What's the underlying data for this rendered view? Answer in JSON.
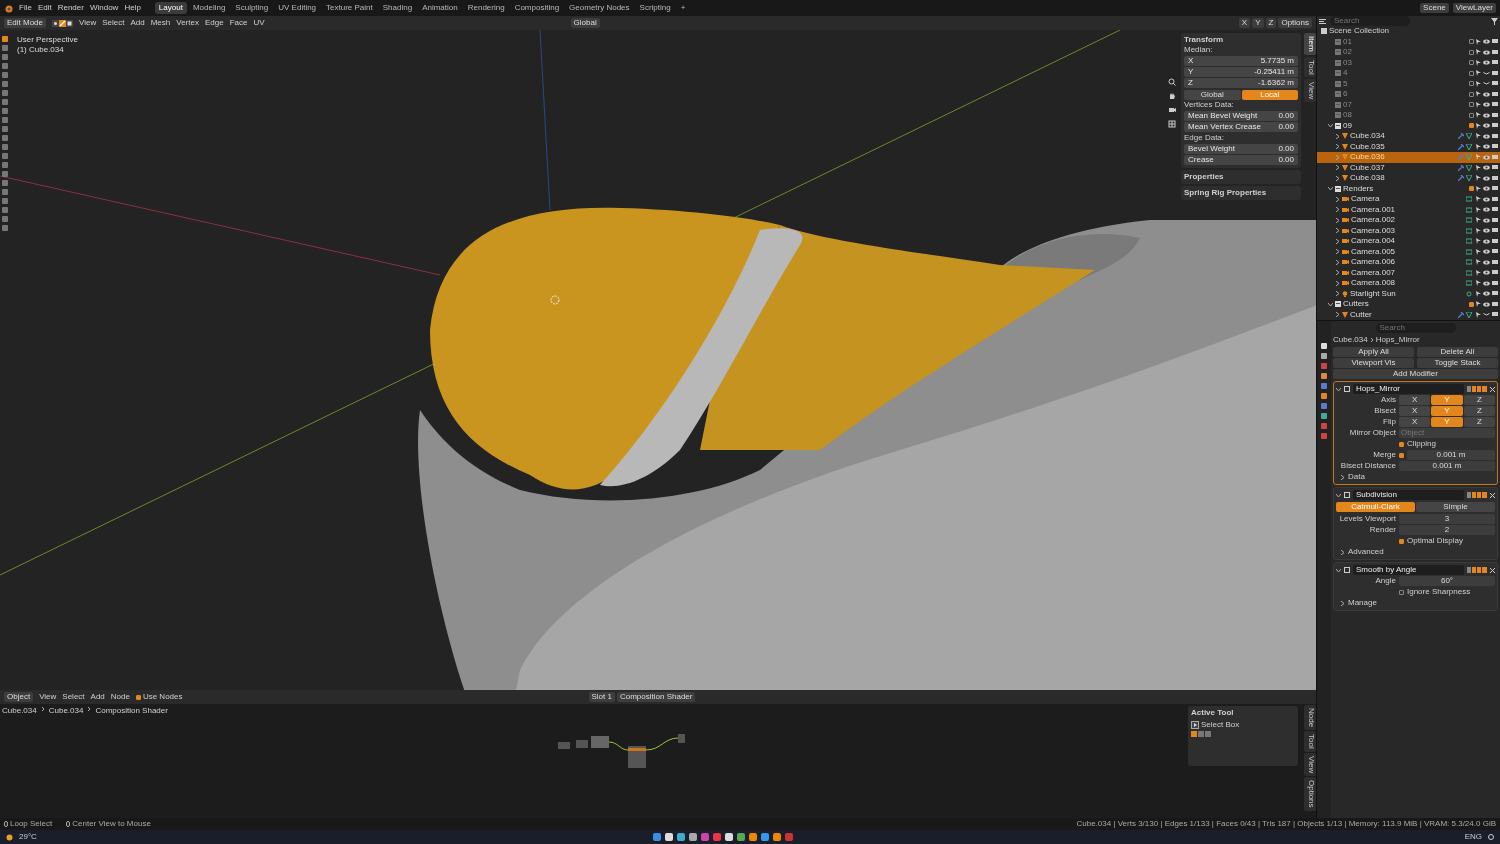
{
  "top_bar": {
    "menus": [
      "File",
      "Edit",
      "Render",
      "Window",
      "Help"
    ],
    "workspaces": [
      {
        "label": "Layout",
        "selected": true
      },
      {
        "label": "Modeling",
        "selected": false
      },
      {
        "label": "Sculpting",
        "selected": false
      },
      {
        "label": "UV Editing",
        "selected": false
      },
      {
        "label": "Texture Paint",
        "selected": false
      },
      {
        "label": "Shading",
        "selected": false
      },
      {
        "label": "Animation",
        "selected": false
      },
      {
        "label": "Rendering",
        "selected": false
      },
      {
        "label": "Compositing",
        "selected": false
      },
      {
        "label": "Geometry Nodes",
        "selected": false
      },
      {
        "label": "Scripting",
        "selected": false
      }
    ],
    "add_tab": "+",
    "scene": "Scene",
    "view_layer": "ViewLayer"
  },
  "viewport_header": {
    "mode": "Edit Mode",
    "select_modes": [
      {
        "kind": "vertex",
        "selected": false
      },
      {
        "kind": "edge",
        "selected": true
      },
      {
        "kind": "face",
        "selected": false
      }
    ],
    "menus": [
      "View",
      "Select",
      "Add",
      "Mesh",
      "Vertex",
      "Edge",
      "Face",
      "UV"
    ],
    "orientation": "Global",
    "axes": [
      "X",
      "Y",
      "Z"
    ],
    "options": "Options"
  },
  "viewport": {
    "perspective": "User Perspective",
    "object": "(1) Cube.034"
  },
  "n_panel": {
    "title": "Transform",
    "median_label": "Median:",
    "median": [
      {
        "label": "X",
        "value": "5.7735 m"
      },
      {
        "label": "Y",
        "value": "-0.25411 m"
      },
      {
        "label": "Z",
        "value": "-1.6362 m"
      }
    ],
    "space": [
      {
        "label": "Global",
        "selected": false
      },
      {
        "label": "Local",
        "selected": true
      }
    ],
    "vertices_label": "Vertices Data:",
    "vertices": [
      {
        "label": "Mean Bevel Weight",
        "value": "0.00"
      },
      {
        "label": "Mean Vertex Crease",
        "value": "0.00"
      }
    ],
    "edges_label": "Edge Data:",
    "edges": [
      {
        "label": "Bevel Weight",
        "value": "0.00"
      },
      {
        "label": "Crease",
        "value": "0.00"
      }
    ],
    "collapsed_panels": [
      "Properties",
      "Spring Rig Properties"
    ],
    "tabs": [
      {
        "label": "Item",
        "selected": true
      },
      {
        "label": "Tool",
        "selected": false
      },
      {
        "label": "View",
        "selected": false
      }
    ]
  },
  "outliner": {
    "search_placeholder": "Search",
    "root": "Scene Collection",
    "items": [
      {
        "label": "01",
        "kind": "collection",
        "checked": false,
        "visible": true
      },
      {
        "label": "02",
        "kind": "collection",
        "checked": false,
        "visible": true
      },
      {
        "label": "03",
        "kind": "collection",
        "checked": false,
        "visible": true
      },
      {
        "label": "4",
        "kind": "collection",
        "checked": false,
        "visible": false
      },
      {
        "label": "5",
        "kind": "collection",
        "checked": false,
        "visible": false
      },
      {
        "label": "6",
        "kind": "collection",
        "checked": false,
        "visible": true
      },
      {
        "label": "07",
        "kind": "collection",
        "checked": false,
        "visible": true
      },
      {
        "label": "08",
        "kind": "collection",
        "checked": false,
        "visible": true
      },
      {
        "label": "09",
        "kind": "collection",
        "checked": true,
        "visible": true,
        "children": [
          {
            "label": "Cube.034",
            "kind": "mesh",
            "selected": false,
            "visible": true
          },
          {
            "label": "Cube.035",
            "kind": "mesh",
            "selected": false,
            "visible": true
          },
          {
            "label": "Cube.036",
            "kind": "mesh",
            "selected": true,
            "visible": true
          },
          {
            "label": "Cube.037",
            "kind": "mesh",
            "selected": false,
            "visible": true
          },
          {
            "label": "Cube.038",
            "kind": "mesh",
            "selected": false,
            "visible": true
          }
        ]
      },
      {
        "label": "Renders",
        "kind": "collection",
        "checked": true,
        "visible": true,
        "children": [
          {
            "label": "Camera",
            "kind": "camera",
            "selected": false,
            "visible": true
          },
          {
            "label": "Camera.001",
            "kind": "camera",
            "selected": false,
            "visible": true
          },
          {
            "label": "Camera.002",
            "kind": "camera",
            "selected": false,
            "visible": true
          },
          {
            "label": "Camera.003",
            "kind": "camera",
            "selected": false,
            "visible": true
          },
          {
            "label": "Camera.004",
            "kind": "camera",
            "selected": false,
            "visible": true
          },
          {
            "label": "Camera.005",
            "kind": "camera",
            "selected": false,
            "visible": true
          },
          {
            "label": "Camera.006",
            "kind": "camera",
            "selected": false,
            "visible": true
          },
          {
            "label": "Camera.007",
            "kind": "camera",
            "selected": false,
            "visible": true
          },
          {
            "label": "Camera.008",
            "kind": "camera",
            "selected": false,
            "visible": true
          },
          {
            "label": "Starlight Sun",
            "kind": "light",
            "selected": false,
            "visible": true
          }
        ]
      },
      {
        "label": "Cutters",
        "kind": "collection",
        "checked": true,
        "visible": true,
        "children": [
          {
            "label": "Cutter",
            "kind": "mesh",
            "selected": false,
            "visible": false
          }
        ]
      }
    ]
  },
  "properties": {
    "search_placeholder": "Search",
    "breadcrumb": [
      "Cube.034",
      "Hops_Mirror"
    ],
    "actions": [
      "Apply All",
      "Delete All",
      "Viewport Vis",
      "Toggle Stack"
    ],
    "add_modifier": "Add Modifier",
    "modifiers": [
      {
        "name": "Hops_Mirror",
        "kind": "mirror",
        "active": true,
        "axis_rows": [
          {
            "label": "Axis",
            "axes": [
              {
                "label": "X",
                "selected": false
              },
              {
                "label": "Y",
                "selected": true
              },
              {
                "label": "Z",
                "selected": false
              }
            ]
          },
          {
            "label": "Bisect",
            "axes": [
              {
                "label": "X",
                "selected": false
              },
              {
                "label": "Y",
                "selected": true
              },
              {
                "label": "Z",
                "selected": false
              }
            ]
          },
          {
            "label": "Flip",
            "axes": [
              {
                "label": "X",
                "selected": false
              },
              {
                "label": "Y",
                "selected": true
              },
              {
                "label": "Z",
                "selected": false
              }
            ]
          }
        ],
        "mirror_object_label": "Mirror Object",
        "mirror_object_placeholder": "Object",
        "clipping": {
          "label": "Clipping",
          "checked": true
        },
        "merge": {
          "label": "Merge",
          "checked": true,
          "value": "0.001 m"
        },
        "bisect_distance": {
          "label": "Bisect Distance",
          "value": "0.001 m"
        },
        "subpanel": "Data"
      },
      {
        "name": "Subdivision",
        "kind": "subdivision",
        "active": false,
        "types": [
          {
            "label": "Catmull-Clark",
            "selected": true
          },
          {
            "label": "Simple",
            "selected": false
          }
        ],
        "fields": [
          {
            "label": "Levels Viewport",
            "value": "3"
          },
          {
            "label": "Render",
            "value": "2"
          }
        ],
        "optimal_display": {
          "label": "Optimal Display",
          "checked": true
        },
        "subpanel": "Advanced"
      },
      {
        "name": "Smooth by Angle",
        "kind": "smooth",
        "active": false,
        "angle": {
          "label": "Angle",
          "value": "60°"
        },
        "ignore_sharpness": {
          "label": "Ignore Sharpness",
          "checked": false
        },
        "subpanel": "Manage"
      }
    ]
  },
  "node_editor": {
    "mode": "Object",
    "menus": [
      "View",
      "Select",
      "Add",
      "Node"
    ],
    "use_nodes": {
      "label": "Use Nodes",
      "checked": true
    },
    "slot": "Slot 1",
    "material": "Composition Shader",
    "breadcrumb": [
      "Cube.034",
      "Cube.034",
      "Composition Shader"
    ],
    "active_tool": {
      "title": "Active Tool",
      "tool": "Select Box"
    },
    "tabs": [
      "Node",
      "Tool",
      "View",
      "Options"
    ]
  },
  "status_bar": {
    "hints": [
      "Loop Select",
      "Center View to Mouse"
    ],
    "stats": "Cube.034 | Verts 3/130 | Edges 1/133 | Faces 0/43 | Tris 187 | Objects 1/13 | Memory: 113.9 MiB | VRAM: 5.3/24.0 GiB"
  },
  "taskbar": {
    "weather": "29°C",
    "language": "ENG"
  }
}
